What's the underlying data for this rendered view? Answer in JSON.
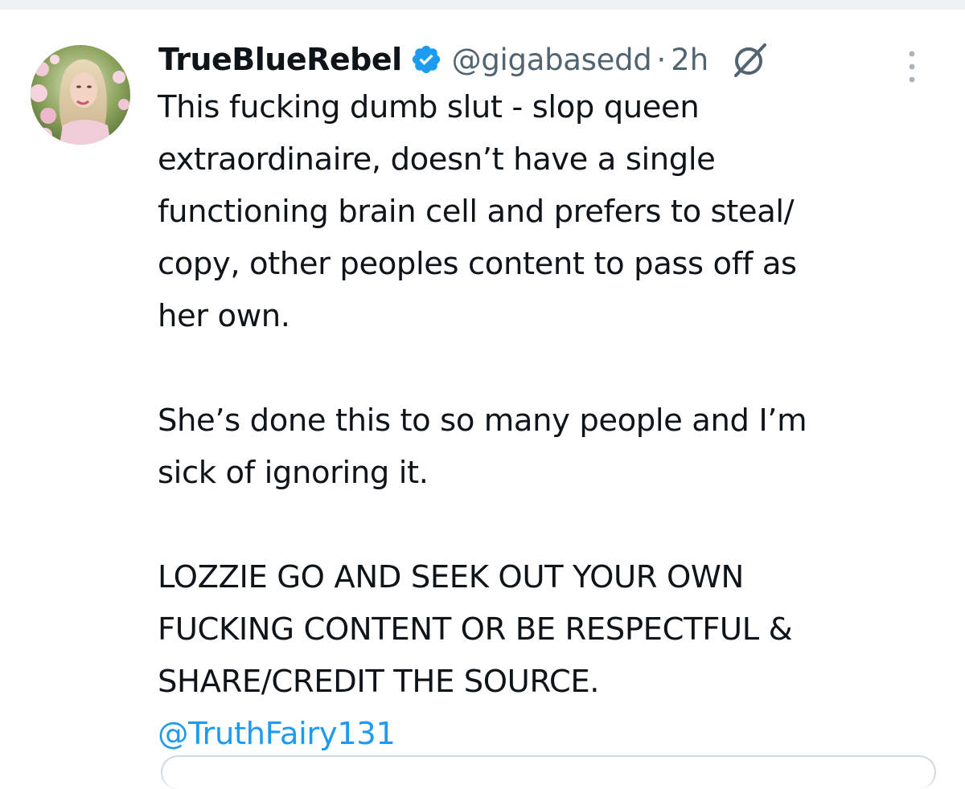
{
  "author": {
    "display_name": "TrueBlueRebel",
    "handle": "@gigabasedd",
    "separator": "·",
    "time": "2h",
    "verified": true
  },
  "icons": {
    "verified": "verified-badge-icon",
    "grok": "grok-icon",
    "more": "more-vertical-icon",
    "avatar": "avatar-image"
  },
  "colors": {
    "text": "#0f1419",
    "secondary": "#536471",
    "accent": "#1d9bf0",
    "border": "#cfd9de"
  },
  "tweet": {
    "paragraph1": [
      "This fucking dumb slut - slop queen",
      "extraordinaire, doesn’t have a single",
      "functioning brain cell and prefers to steal/",
      "copy, other peoples content to pass off as",
      "her own."
    ],
    "paragraph2": [
      "She’s done this to so many people and I’m",
      "sick of ignoring it."
    ],
    "paragraph3": [
      "LOZZIE GO AND SEEK OUT YOUR OWN",
      "FUCKING CONTENT OR BE RESPECTFUL &",
      "SHARE/CREDIT THE SOURCE."
    ],
    "mention": "@TruthFairy131"
  }
}
